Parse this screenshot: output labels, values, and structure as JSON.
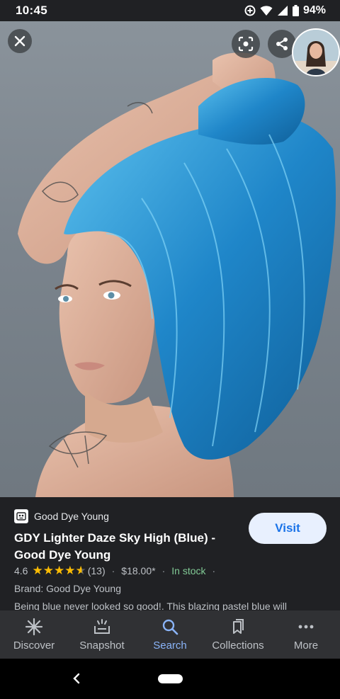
{
  "status_bar": {
    "time": "10:45",
    "battery": "94%"
  },
  "hero": {
    "image_description": "",
    "close_icon": "close-icon",
    "lens_icon": "lens-icon",
    "share_icon": "share-icon"
  },
  "product": {
    "source": "Good Dye Young",
    "title": "GDY Lighter Daze Sky High (Blue) - Good Dye Young",
    "visit_label": "Visit",
    "rating": "4.6",
    "rating_stars": 4.6,
    "review_count": "(13)",
    "price": "$18.00*",
    "availability": "In stock",
    "brand": "Brand: Good Dye Young",
    "description": "Being blue never looked so good!. This blazing pastel blue will"
  },
  "nav": {
    "items": [
      {
        "label": "Discover",
        "icon": "asterisk-icon"
      },
      {
        "label": "Snapshot",
        "icon": "snapshot-icon"
      },
      {
        "label": "Search",
        "icon": "search-icon",
        "active": true
      },
      {
        "label": "Collections",
        "icon": "collections-icon"
      },
      {
        "label": "More",
        "icon": "more-dots-icon"
      }
    ]
  },
  "colors": {
    "accent": "#8ab4f8",
    "visit_bg": "#e8f0fe",
    "visit_text": "#1a73e8",
    "stock": "#81c995",
    "star": "#fbbc04",
    "panel_bg": "#202124",
    "nav_bg": "#303134"
  }
}
